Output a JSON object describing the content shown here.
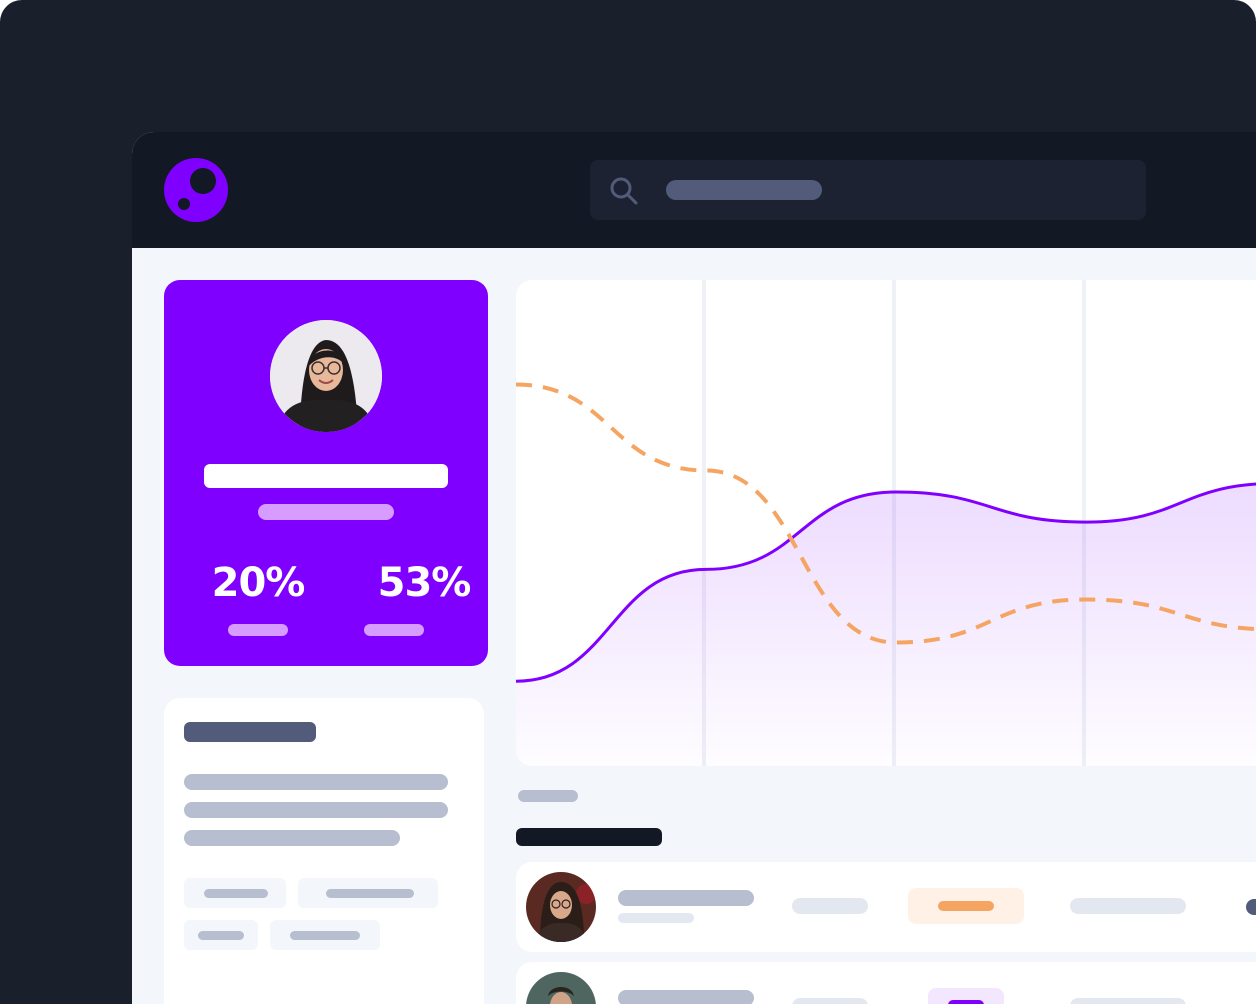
{
  "app": {
    "logo_icon": "brand-logo-icon",
    "brand_color": "#8000ff",
    "accent_orange": "#f5a462"
  },
  "search": {
    "icon": "search-icon",
    "placeholder": ""
  },
  "profile": {
    "avatar_icon": "user-avatar",
    "stats": [
      {
        "value": "20%"
      },
      {
        "value": "53%"
      }
    ]
  },
  "chart_data": {
    "type": "area",
    "series": [
      {
        "style": "solid-area",
        "color": "#8000ff",
        "values": [
          0.16,
          0.42,
          0.6,
          0.53,
          0.62
        ]
      },
      {
        "style": "dashed-line",
        "color": "#f5a462",
        "values": [
          0.85,
          0.65,
          0.25,
          0.35,
          0.28
        ]
      }
    ],
    "grid": "vertical",
    "legend": "none"
  },
  "table": {
    "rows": [
      {
        "avatar_icon": "user-avatar",
        "badge_color": "#f5a462",
        "badge_bg": "#fff1e6"
      },
      {
        "avatar_icon": "user-avatar",
        "badge_color": "#8000ff",
        "badge_bg": "#f3e6ff"
      }
    ]
  }
}
